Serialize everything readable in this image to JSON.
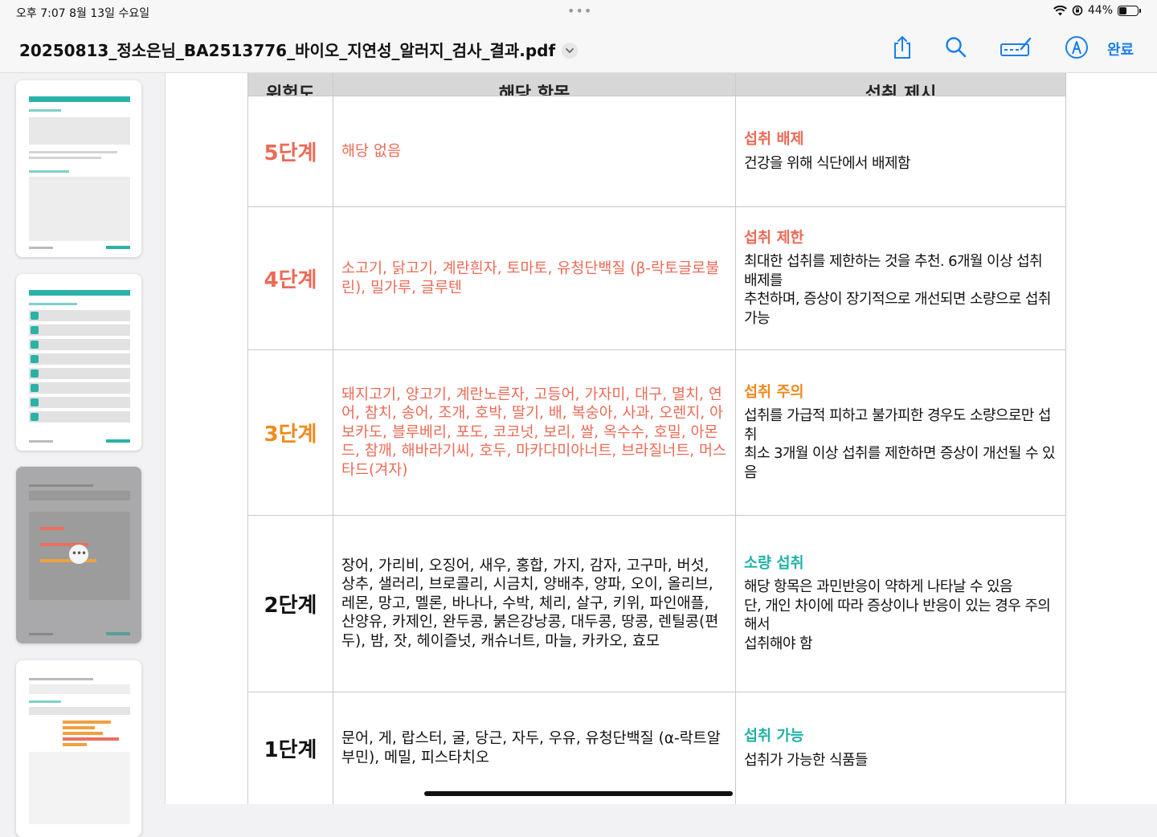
{
  "status_bar": {
    "time": "오후 7:07  8월 13일 수요일",
    "battery": "44%",
    "battery_level": 0.44
  },
  "toolbar": {
    "title": "20250813_정소은님_BA2513776_바이오_지연성_알러지_검사_결과.pdf",
    "done_label": "완료",
    "icons": [
      "share-icon",
      "search-icon",
      "markup-icon",
      "pen-icon"
    ]
  },
  "table": {
    "headers": [
      "위험도",
      "해당 항목",
      "섭취 제시"
    ],
    "rows": [
      {
        "level": "5단계",
        "items": "해당 없음",
        "rec_title": "섭취 배제",
        "rec_desc": [
          "건강을 위해 식단에서 배제함"
        ],
        "color": "#ec6a56"
      },
      {
        "level": "4단계",
        "items": "소고기, 닭고기, 계란흰자, 토마토, 유청단백질 (β-락토글로불린), 밀가루, 글루텐",
        "rec_title": "섭취 제한",
        "rec_desc": [
          "최대한 섭취를 제한하는 것을 추천. 6개월 이상 섭취 배제를",
          "추천하며, 증상이 장기적으로 개선되면 소량으로 섭취 가능"
        ],
        "color": "#ec6a56"
      },
      {
        "level": "3단계",
        "items": "돼지고기, 양고기, 계란노른자, 고등어, 가자미, 대구, 멸치, 연어, 참치, 송어, 조개, 호박, 딸기, 배, 복숭아, 사과, 오렌지, 아보카도, 블루베리, 포도, 코코넛, 보리, 쌀, 옥수수, 호밀, 아몬드, 참깨, 해바라기씨, 호두, 마카다미아너트, 브라질너트, 머스타드(겨자)",
        "rec_title": "섭취 주의",
        "rec_desc": [
          "섭취를 가급적 피하고 불가피한 경우도 소량으로만 섭취",
          "최소 3개월 이상 섭취를 제한하면 증상이 개선될 수 있음"
        ],
        "color": "#f08a1c"
      },
      {
        "level": "2단계",
        "items": "장어, 가리비, 오징어, 새우, 홍합, 가지, 감자, 고구마, 버섯, 상추, 샐러리, 브로콜리, 시금치, 양배추, 양파, 오이, 올리브, 레몬, 망고, 멜론, 바나나, 수박, 체리, 살구, 키위, 파인애플, 산양유, 카제인, 완두콩, 붉은강낭콩, 대두콩, 땅콩, 렌틸콩(편두), 밤, 잣, 헤이즐넛, 캐슈너트, 마늘, 카카오, 효모",
        "rec_title": "소량 섭취",
        "rec_desc": [
          "해당 항목은 과민반응이 약하게 나타날 수 있음",
          "단, 개인 차이에 따라 증상이나 반응이 있는 경우 주의 해서",
          "섭취해야 함"
        ],
        "color": "#111111"
      },
      {
        "level": "1단계",
        "items": "문어, 게, 랍스터, 굴, 당근, 자두, 우유, 유청단백질 (α-락트알부민), 메밀, 피스타치오",
        "rec_title": "섭취 가능",
        "rec_desc": [
          "섭취가 가능한 식품들"
        ],
        "color": "#111111"
      }
    ]
  },
  "colors": {
    "accent": "#1a7fea",
    "teal": "#1fb2a6",
    "red": "#ec6a56",
    "orange": "#f08a1c"
  }
}
